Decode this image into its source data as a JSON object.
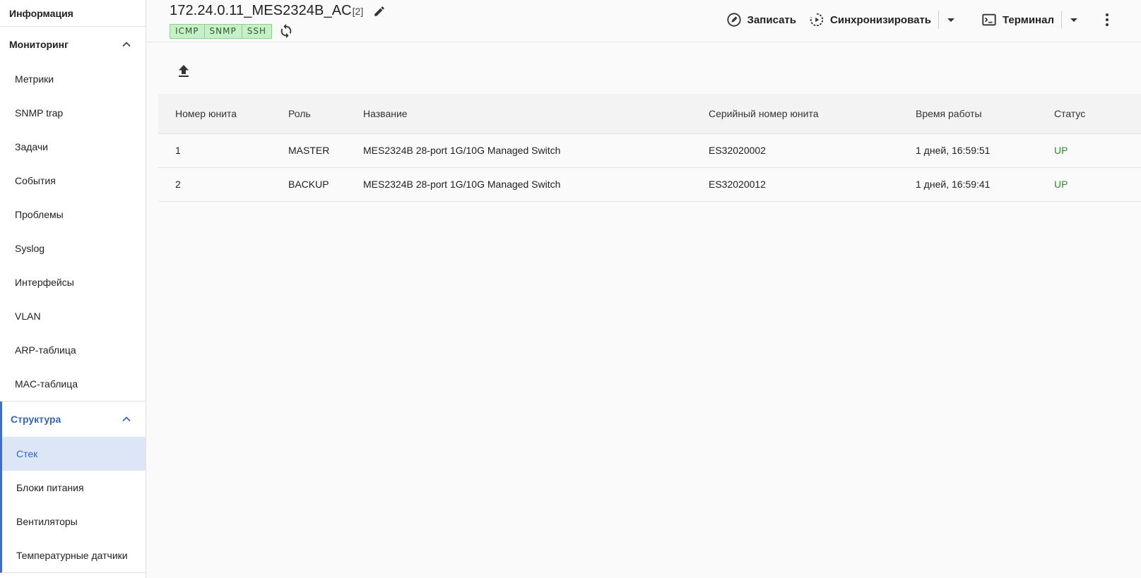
{
  "sidebar": {
    "info_label": "Информация",
    "monitoring": {
      "title": "Мониторинг",
      "items": [
        "Метрики",
        "SNMP trap",
        "Задачи",
        "События",
        "Проблемы",
        "Syslog",
        "Интерфейсы",
        "VLAN",
        "ARP-таблица",
        "MAC-таблица"
      ]
    },
    "structure": {
      "title": "Структура",
      "items": [
        "Стек",
        "Блоки питания",
        "Вентиляторы",
        "Температурные датчики"
      ],
      "selected": "Стек"
    }
  },
  "header": {
    "device_title": "172.24.0.11_MES2324B_AC",
    "device_count": "[2]",
    "badges": [
      "ICMP",
      "SNMP",
      "SSH"
    ],
    "actions": {
      "write_label": "Записать",
      "sync_label": "Синхронизировать",
      "terminal_label": "Терминал"
    }
  },
  "table": {
    "columns": [
      "Номер юнита",
      "Роль",
      "Название",
      "Серийный номер юнита",
      "Время работы",
      "Статус"
    ],
    "rows": [
      {
        "unit": "1",
        "role": "MASTER",
        "name": "MES2324B 28-port 1G/10G Managed Switch",
        "serial": "ES32020002",
        "uptime": "1 дней, 16:59:51",
        "status": "UP"
      },
      {
        "unit": "2",
        "role": "BACKUP",
        "name": "MES2324B 28-port 1G/10G Managed Switch",
        "serial": "ES32020012",
        "uptime": "1 дней, 16:59:41",
        "status": "UP"
      }
    ]
  },
  "colors": {
    "accent": "#3466b8",
    "selected_bg": "#dde6f6",
    "status_up": "#2e8b2e",
    "badge_bg": "#c8f0c8"
  }
}
